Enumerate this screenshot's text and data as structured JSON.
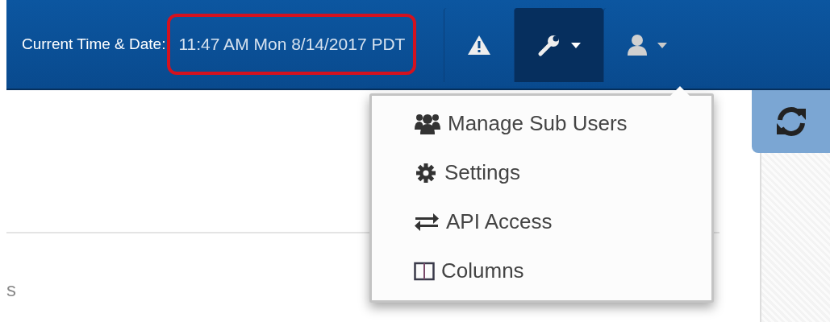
{
  "header": {
    "label": "Current Time & Date:",
    "time": "11:47 AM Mon 8/14/2017 PDT",
    "time_highlighted": true
  },
  "toolbar": [
    {
      "kind": "warning",
      "caret": false,
      "expanded": false
    },
    {
      "kind": "wrench",
      "caret": true,
      "expanded": true
    },
    {
      "kind": "user",
      "caret": true,
      "expanded": false
    }
  ],
  "menu": [
    {
      "kind": "users",
      "label": "Manage Sub Users"
    },
    {
      "kind": "gear",
      "label": "Settings"
    },
    {
      "kind": "exchange",
      "label": "API Access"
    },
    {
      "kind": "columns",
      "label": "Columns"
    }
  ],
  "content": {
    "heading_fragment": "s"
  }
}
